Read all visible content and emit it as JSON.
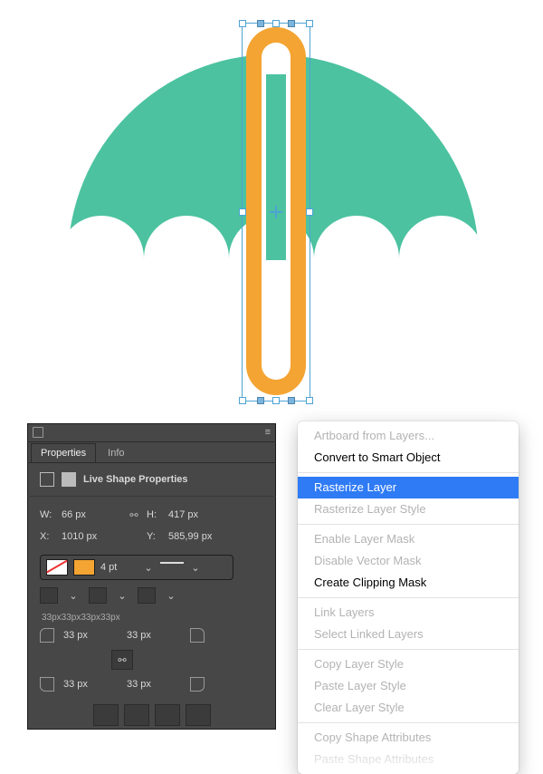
{
  "panel": {
    "tabs": {
      "properties": "Properties",
      "info": "Info"
    },
    "section_title": "Live Shape Properties",
    "fields": {
      "w_label": "W:",
      "w_value": "66 px",
      "h_label": "H:",
      "h_value": "417 px",
      "x_label": "X:",
      "x_value": "1010 px",
      "y_label": "Y:",
      "y_value": "585,99 px",
      "stroke_weight": "4 pt"
    },
    "radius_summary": "33px33px33px33px",
    "radii": {
      "tl": "33 px",
      "tr": "33 px",
      "bl": "33 px",
      "br": "33 px"
    },
    "colors": {
      "stroke": "#f4a432"
    }
  },
  "menu": {
    "artboard_from_layers": "Artboard from Layers...",
    "convert_smart_object": "Convert to Smart Object",
    "rasterize_layer": "Rasterize Layer",
    "rasterize_layer_style": "Rasterize Layer Style",
    "enable_layer_mask": "Enable Layer Mask",
    "disable_vector_mask": "Disable Vector Mask",
    "create_clipping_mask": "Create Clipping Mask",
    "link_layers": "Link Layers",
    "select_linked_layers": "Select Linked Layers",
    "copy_layer_style": "Copy Layer Style",
    "paste_layer_style": "Paste Layer Style",
    "clear_layer_style": "Clear Layer Style",
    "copy_shape_attributes": "Copy Shape Attributes",
    "paste_shape_attributes": "Paste Shape Attributes"
  }
}
